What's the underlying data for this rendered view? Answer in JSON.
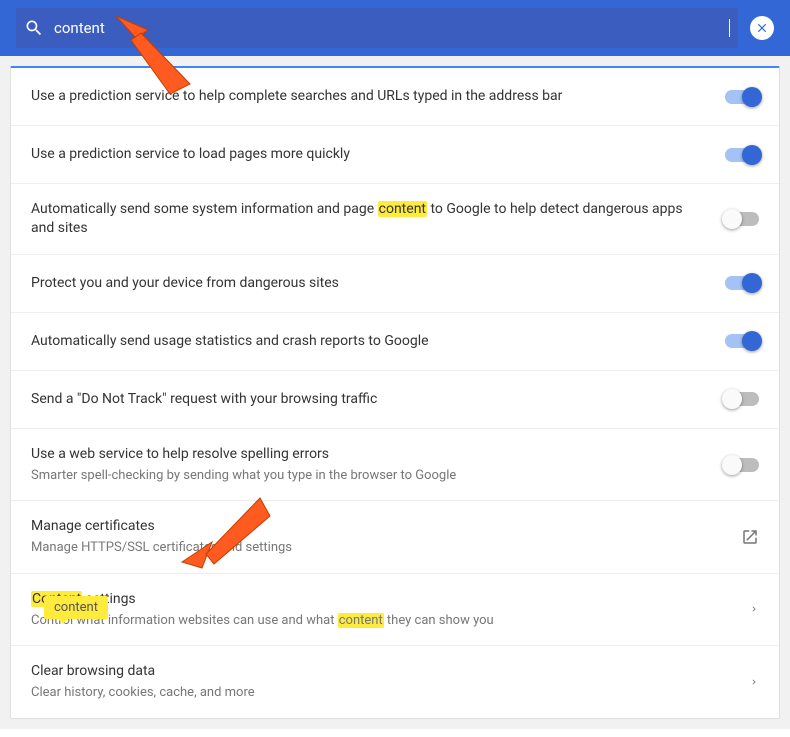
{
  "search": {
    "value": "content",
    "highlight": "content"
  },
  "rows": [
    {
      "id": "predict-url",
      "kind": "toggle",
      "on": true,
      "title": "Use a prediction service to help complete searches and URLs typed in the address bar"
    },
    {
      "id": "predict-pages",
      "kind": "toggle",
      "on": true,
      "title": "Use a prediction service to load pages more quickly"
    },
    {
      "id": "sys-info",
      "kind": "toggle",
      "on": false,
      "title": "Automatically send some system information and page content to Google to help detect dangerous apps and sites"
    },
    {
      "id": "safe-browsing",
      "kind": "toggle",
      "on": true,
      "title": "Protect you and your device from dangerous sites"
    },
    {
      "id": "usage-stats",
      "kind": "toggle",
      "on": true,
      "title": "Automatically send usage statistics and crash reports to Google"
    },
    {
      "id": "dnt",
      "kind": "toggle",
      "on": false,
      "title": "Send a \"Do Not Track\" request with your browsing traffic"
    },
    {
      "id": "spellcheck",
      "kind": "toggle",
      "on": false,
      "title": "Use a web service to help resolve spelling errors",
      "sub": "Smarter spell-checking by sending what you type in the browser to Google"
    },
    {
      "id": "certs",
      "kind": "external",
      "title": "Manage certificates",
      "sub": "Manage HTTPS/SSL certificates and settings"
    },
    {
      "id": "content-settings",
      "kind": "nav",
      "title": "Content settings",
      "sub": "Control what information websites can use and what content they can show you"
    },
    {
      "id": "clear-data",
      "kind": "nav",
      "title": "Clear browsing data",
      "sub": "Clear history, cookies, cache, and more"
    }
  ],
  "tooltip": {
    "text": "content"
  }
}
